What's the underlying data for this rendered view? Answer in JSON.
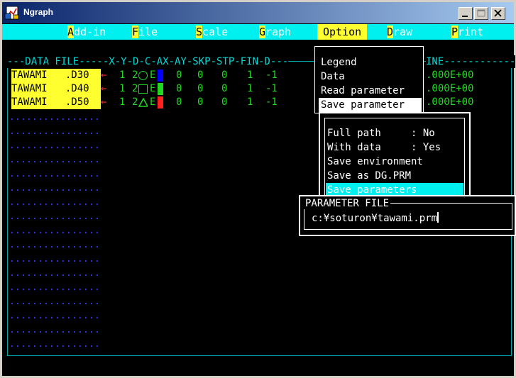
{
  "window": {
    "title": "Ngraph"
  },
  "menu": {
    "items": [
      {
        "hot": "A",
        "rest": "dd-in"
      },
      {
        "hot": "F",
        "rest": "ile"
      },
      {
        "hot": "S",
        "rest": "cale"
      },
      {
        "hot": "G",
        "rest": "raph"
      },
      {
        "hot": "",
        "rest": "Option"
      },
      {
        "hot": "D",
        "rest": "raw"
      },
      {
        "hot": "P",
        "rest": "rint"
      }
    ]
  },
  "header": {
    "left": "---DATA FILE-----X-Y-D-C-AX-AY-SKP-STP-FIN-D---",
    "right": "INE------------"
  },
  "files": [
    {
      "name": "TAWAMI   .D30",
      "x": "1",
      "y": "2",
      "mark": "circle",
      "e": "E",
      "color": "#0000ff",
      "ax": "0",
      "ay": "0",
      "skp": "0",
      "stp": "1",
      "fin": "-1",
      "right": ".000E+00"
    },
    {
      "name": "TAWAMI   .D40",
      "x": "1",
      "y": "2",
      "mark": "square",
      "e": "E",
      "color": "#20d820",
      "ax": "0",
      "ay": "0",
      "skp": "0",
      "stp": "1",
      "fin": "-1",
      "right": ".000E+00"
    },
    {
      "name": "TAWAMI   .D50",
      "x": "1",
      "y": "2",
      "mark": "triangle",
      "e": "E",
      "color": "#ff2020",
      "ax": "0",
      "ay": "0",
      "skp": "0",
      "stp": "1",
      "fin": "-1",
      "right": ".000E+00"
    }
  ],
  "arrow_glyph": "←",
  "option_menu": {
    "items": [
      "Legend",
      "Data",
      "Read parameter",
      "Save parameter"
    ],
    "selected": 3
  },
  "save_menu": {
    "items": [
      "Full path     : No",
      "With data     : Yes",
      "Save environment",
      "Save as DG.PRM",
      "Save parameters"
    ],
    "selected": 4
  },
  "parameter_file": {
    "label": "PARAMETER FILE",
    "value": "c:¥soturon¥tawami.prm"
  },
  "colors": {
    "menubar": "#00f0f0",
    "hotkey": "#ffff30",
    "frame": "#00a8a8"
  }
}
